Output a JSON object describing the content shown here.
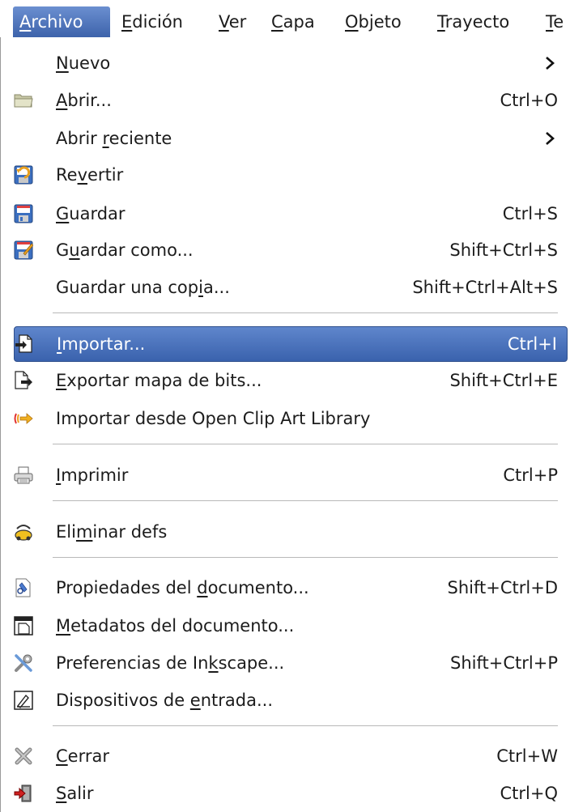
{
  "menubar": {
    "items": [
      {
        "mnemonic": "A",
        "rest": "rchivo"
      },
      {
        "mnemonic": "E",
        "rest": "dición"
      },
      {
        "mnemonic": "V",
        "rest": "er"
      },
      {
        "mnemonic": "C",
        "rest": "apa"
      },
      {
        "mnemonic": "O",
        "rest": "bjeto"
      },
      {
        "mnemonic": "T",
        "rest": "rayecto"
      },
      {
        "mnemonic": "T",
        "rest": "e"
      }
    ]
  },
  "menu": {
    "items": [
      {
        "pre": "",
        "u": "N",
        "post": "uevo",
        "accel": "",
        "submenu": true,
        "icon": "none"
      },
      {
        "pre": "",
        "u": "A",
        "post": "brir...",
        "accel": "Ctrl+O",
        "icon": "folder-open-icon"
      },
      {
        "pre": "Abrir ",
        "u": "r",
        "post": "eciente",
        "accel": "",
        "submenu": true,
        "icon": "none"
      },
      {
        "pre": "Re",
        "u": "v",
        "post": "ertir",
        "accel": "",
        "icon": "revert-icon"
      },
      {
        "pre": "",
        "u": "G",
        "post": "uardar",
        "accel": "Ctrl+S",
        "icon": "save-icon"
      },
      {
        "pre": "G",
        "u": "u",
        "post": "ardar como...",
        "accel": "Shift+Ctrl+S",
        "icon": "save-as-icon"
      },
      {
        "pre": "Guardar una cop",
        "u": "i",
        "post": "a...",
        "accel": "Shift+Ctrl+Alt+S",
        "icon": "none"
      },
      {
        "pre": "",
        "u": "I",
        "post": "mportar...",
        "accel": "Ctrl+I",
        "icon": "import-icon",
        "highlighted": true
      },
      {
        "pre": "",
        "u": "E",
        "post": "xportar mapa de bits...",
        "accel": "Shift+Ctrl+E",
        "icon": "export-icon"
      },
      {
        "pre": "Importar desde Open Clip Art Library",
        "u": "",
        "post": "",
        "accel": "",
        "icon": "openclipart-icon"
      },
      {
        "pre": "",
        "u": "I",
        "post": "mprimir",
        "accel": "Ctrl+P",
        "icon": "print-icon"
      },
      {
        "pre": "Eli",
        "u": "m",
        "post": "inar defs",
        "accel": "",
        "icon": "vacuum-defs-icon"
      },
      {
        "pre": "Propiedades del ",
        "u": "d",
        "post": "ocumento...",
        "accel": "Shift+Ctrl+D",
        "icon": "document-properties-icon"
      },
      {
        "pre": "",
        "u": "M",
        "post": "etadatos del documento...",
        "accel": "",
        "icon": "document-metadata-icon"
      },
      {
        "pre": "Preferencias de In",
        "u": "k",
        "post": "scape...",
        "accel": "Shift+Ctrl+P",
        "icon": "preferences-icon"
      },
      {
        "pre": "Dispositivos de ",
        "u": "e",
        "post": "ntrada...",
        "accel": "",
        "icon": "input-devices-icon"
      },
      {
        "pre": "",
        "u": "C",
        "post": "errar",
        "accel": "Ctrl+W",
        "icon": "close-icon"
      },
      {
        "pre": "",
        "u": "S",
        "post": "alir",
        "accel": "Ctrl+Q",
        "icon": "quit-icon"
      }
    ]
  },
  "colors": {
    "highlight": "#3d63ab",
    "highlight_text": "#ffffff",
    "text": "#1c1c1c",
    "separator": "#b8b8b8"
  }
}
